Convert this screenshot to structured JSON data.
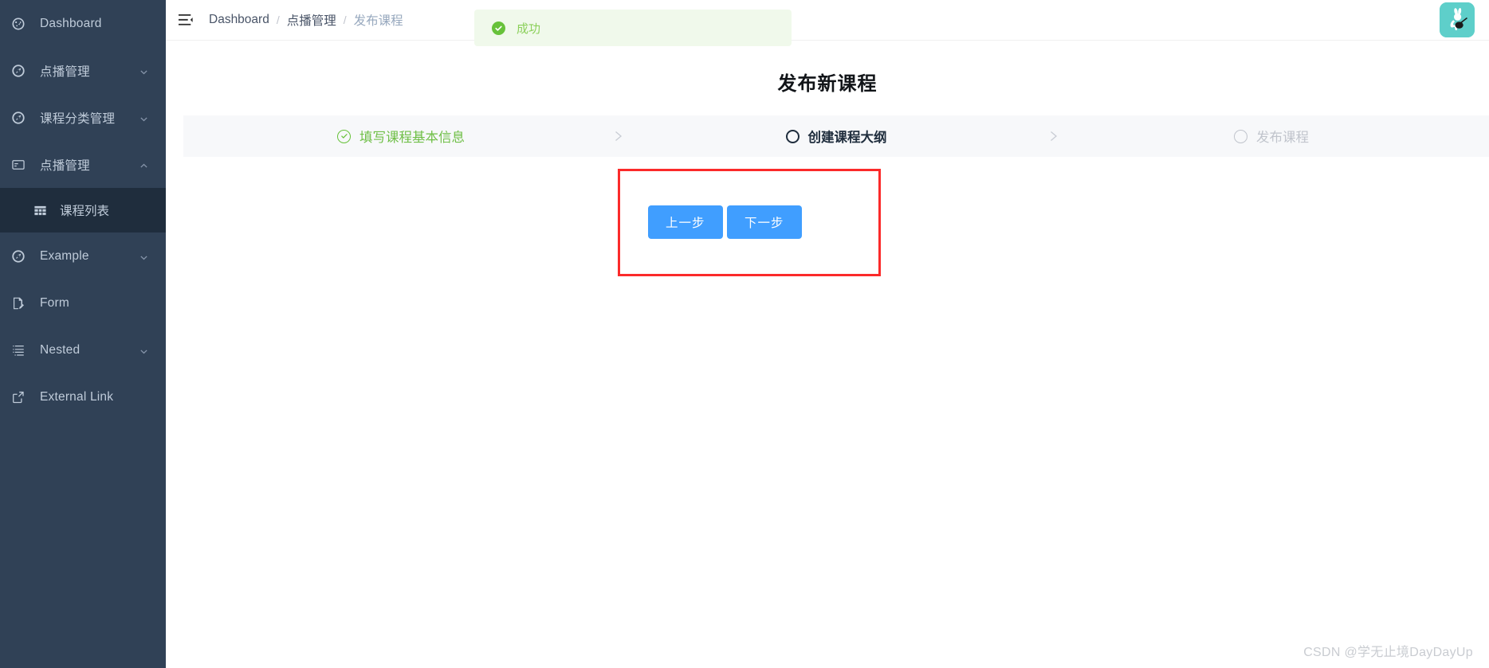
{
  "theme": {
    "sidebar_bg": "#304156",
    "sidebar_active_bg": "#1f2d3d",
    "sidebar_text": "#bfcbd9",
    "primary_blue": "#409eff",
    "success_green": "#67c23a",
    "alert_bg": "#f0f9eb",
    "steps_bg": "#f7f8fa",
    "highlight_red": "#fb2a2a",
    "avatar_bg": "#5ecfca"
  },
  "sidebar": {
    "items": [
      {
        "label": "Dashboard",
        "icon": "dashboard-icon",
        "has_chevron": false,
        "expanded": false
      },
      {
        "label": "点播管理",
        "icon": "compass-icon",
        "has_chevron": true,
        "expanded": false
      },
      {
        "label": "课程分类管理",
        "icon": "compass-icon",
        "has_chevron": true,
        "expanded": false
      },
      {
        "label": "点播管理",
        "icon": "card-icon",
        "has_chevron": true,
        "expanded": true
      },
      {
        "label": "Example",
        "icon": "compass-icon",
        "has_chevron": true,
        "expanded": false
      },
      {
        "label": "Form",
        "icon": "form-icon",
        "has_chevron": false,
        "expanded": false
      },
      {
        "label": "Nested",
        "icon": "nested-list-icon",
        "has_chevron": true,
        "expanded": false
      },
      {
        "label": "External Link",
        "icon": "external-link-icon",
        "has_chevron": false,
        "expanded": false
      }
    ],
    "submenu": {
      "label": "课程列表",
      "icon": "table-icon",
      "parent_index": 3,
      "selected": true
    }
  },
  "navbar": {
    "hamburger_icon": "hamburger-collapse-icon",
    "breadcrumb": [
      {
        "label": "Dashboard",
        "state": "link"
      },
      {
        "label": "点播管理",
        "state": "link"
      },
      {
        "label": "发布课程",
        "state": "current"
      }
    ],
    "separator": "/",
    "avatar_icon": "user-avatar-rabbit"
  },
  "alert": {
    "icon": "success-check-icon",
    "text": "成功",
    "type": "success"
  },
  "page": {
    "title": "发布新课程"
  },
  "steps": [
    {
      "label": "填写课程基本信息",
      "state": "done",
      "icon": "check-circle-icon"
    },
    {
      "label": "创建课程大纲",
      "state": "active",
      "icon": "circle-icon"
    },
    {
      "label": "发布课程",
      "state": "pending",
      "icon": "circle-icon"
    }
  ],
  "step_separator_icon": "chevron-right-icon",
  "form_panel": {
    "buttons": [
      {
        "label": "上一步",
        "name": "previous-step-button"
      },
      {
        "label": "下一步",
        "name": "next-step-button"
      }
    ]
  },
  "watermark": {
    "text": "CSDN @学无止境DayDayUp"
  }
}
